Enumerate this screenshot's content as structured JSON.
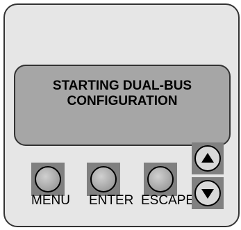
{
  "display": {
    "line1": "STARTING DUAL-BUS",
    "line2": "CONFIGURATION"
  },
  "buttons": {
    "menu": "MENU",
    "enter": "ENTER",
    "escape": "ESCAPE"
  },
  "icons": {
    "up": "arrow-up-icon",
    "down": "arrow-down-icon"
  },
  "colors": {
    "panel": "#e6e6e6",
    "display": "#a6a6a6",
    "button_frame": "#808080"
  }
}
